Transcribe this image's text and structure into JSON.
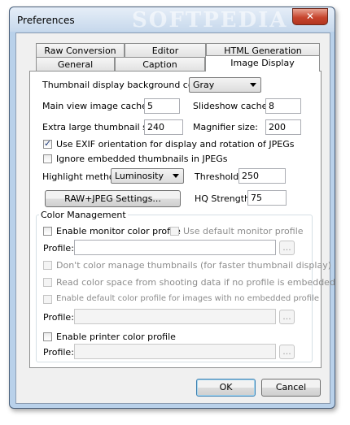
{
  "window": {
    "title": "Preferences",
    "watermark": "SOFTPEDIA",
    "close_glyph": "✕"
  },
  "tabs": {
    "row1": [
      "Raw Conversion",
      "Editor",
      "HTML Generation"
    ],
    "row2": [
      "General",
      "Caption",
      "Image Display"
    ],
    "active": "Image Display"
  },
  "display": {
    "bg_color_label": "Thumbnail display background color:",
    "bg_color_value": "Gray",
    "cache_label": "Main view image cache:",
    "cache_value": "5",
    "slideshow_label": "Slideshow cache:",
    "slideshow_value": "8",
    "xl_thumb_label": "Extra large thumbnail size:",
    "xl_thumb_value": "240",
    "magnifier_label": "Magnifier size:",
    "magnifier_value": "200",
    "exif_label": "Use EXIF orientation for display and rotation of JPEGs",
    "exif_checked": true,
    "ignore_thumb_label": "Ignore embedded thumbnails in JPEGs",
    "ignore_thumb_checked": false,
    "highlight_label": "Highlight method:",
    "highlight_value": "Luminosity",
    "threshold_label": "Threshold:",
    "threshold_value": "250",
    "raw_button": "RAW+JPEG Settings...",
    "hq_label": "HQ Strength:",
    "hq_value": "75"
  },
  "color_mgmt": {
    "group_title": "Color Management",
    "monitor_label": "Enable monitor color profile",
    "default_monitor_label": "Use default monitor profile",
    "profile_label": "Profile:",
    "browse_label": "...",
    "no_thumb_label": "Don't color manage thumbnails (for faster thumbnail display)",
    "shooting_label": "Read color space from shooting data if no profile is embedded",
    "default_profile_label": "Enable default color profile for images with no embedded profile",
    "printer_label": "Enable printer color profile"
  },
  "footer": {
    "ok": "OK",
    "cancel": "Cancel"
  }
}
